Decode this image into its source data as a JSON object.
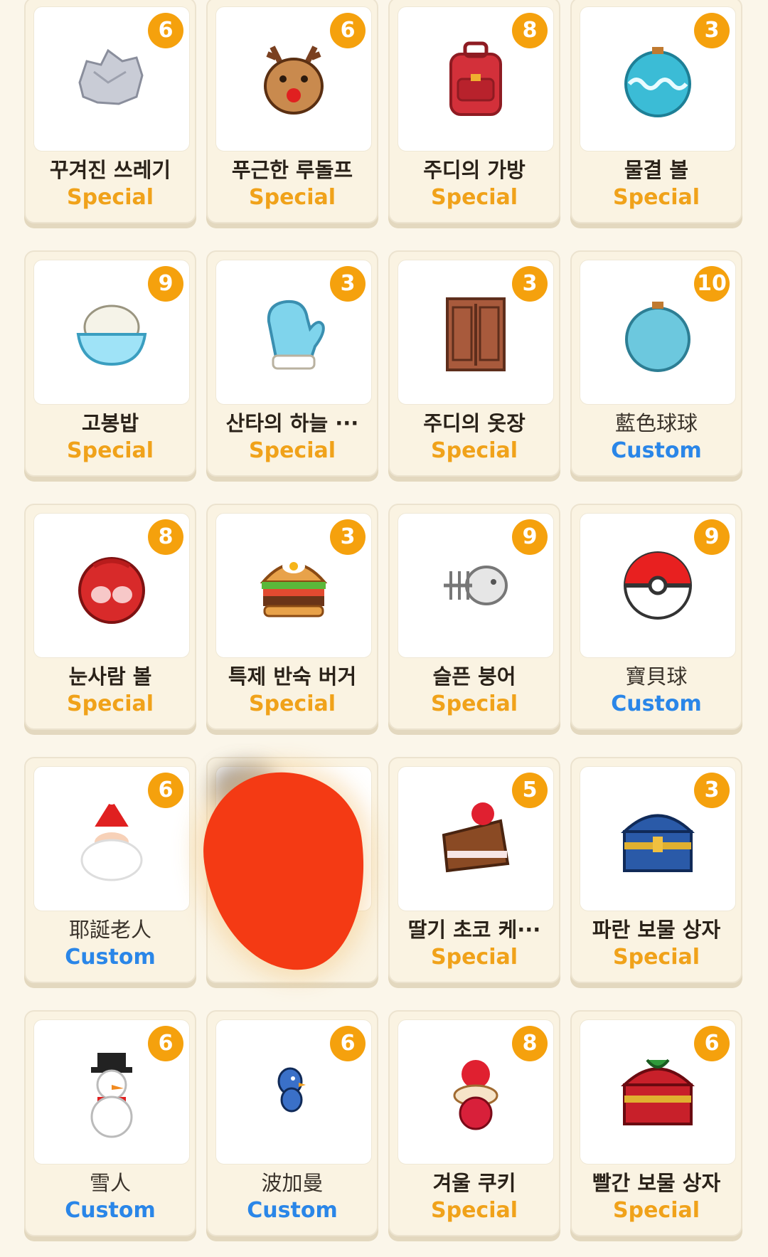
{
  "items": [
    {
      "name": "꾸겨진 쓰레기",
      "type": "Special",
      "badge": "6",
      "icon": "crumpled-paper-icon"
    },
    {
      "name": "푸근한 루돌프",
      "type": "Special",
      "badge": "6",
      "icon": "reindeer-icon"
    },
    {
      "name": "주디의 가방",
      "type": "Special",
      "badge": "8",
      "icon": "red-backpack-icon"
    },
    {
      "name": "물결 볼",
      "type": "Special",
      "badge": "3",
      "icon": "wave-ornament-icon"
    },
    {
      "name": "고봉밥",
      "type": "Special",
      "badge": "9",
      "icon": "rice-bowl-icon"
    },
    {
      "name": "산타의 하늘 ···",
      "type": "Special",
      "badge": "3",
      "icon": "mitten-icon"
    },
    {
      "name": "주디의 옷장",
      "type": "Special",
      "badge": "3",
      "icon": "wardrobe-icon"
    },
    {
      "name": "藍色球球",
      "type": "Custom",
      "badge": "10",
      "icon": "blue-ornament-icon"
    },
    {
      "name": "눈사람 볼",
      "type": "Special",
      "badge": "8",
      "icon": "snowman-ornament-icon"
    },
    {
      "name": "특제 반숙 버거",
      "type": "Special",
      "badge": "3",
      "icon": "burger-icon"
    },
    {
      "name": "슬픈 붕어",
      "type": "Special",
      "badge": "9",
      "icon": "fish-bone-icon"
    },
    {
      "name": "寶貝球",
      "type": "Custom",
      "badge": "9",
      "icon": "pokeball-icon"
    },
    {
      "name": "耶誕老人",
      "type": "Custom",
      "badge": "6",
      "icon": "santa-icon"
    },
    {
      "name": "",
      "type": "",
      "badge": "",
      "icon": "redacted"
    },
    {
      "name": "딸기 초코 케···",
      "type": "Special",
      "badge": "5",
      "icon": "cake-icon"
    },
    {
      "name": "파란 보물 상자",
      "type": "Special",
      "badge": "3",
      "icon": "blue-chest-icon"
    },
    {
      "name": "雪人",
      "type": "Custom",
      "badge": "6",
      "icon": "snowman-icon"
    },
    {
      "name": "波加曼",
      "type": "Custom",
      "badge": "6",
      "icon": "piplup-icon"
    },
    {
      "name": "겨울 쿠키",
      "type": "Special",
      "badge": "8",
      "icon": "strawberry-cookie-icon"
    },
    {
      "name": "빨간 보물 상자",
      "type": "Special",
      "badge": "6",
      "icon": "red-chest-icon"
    }
  ]
}
